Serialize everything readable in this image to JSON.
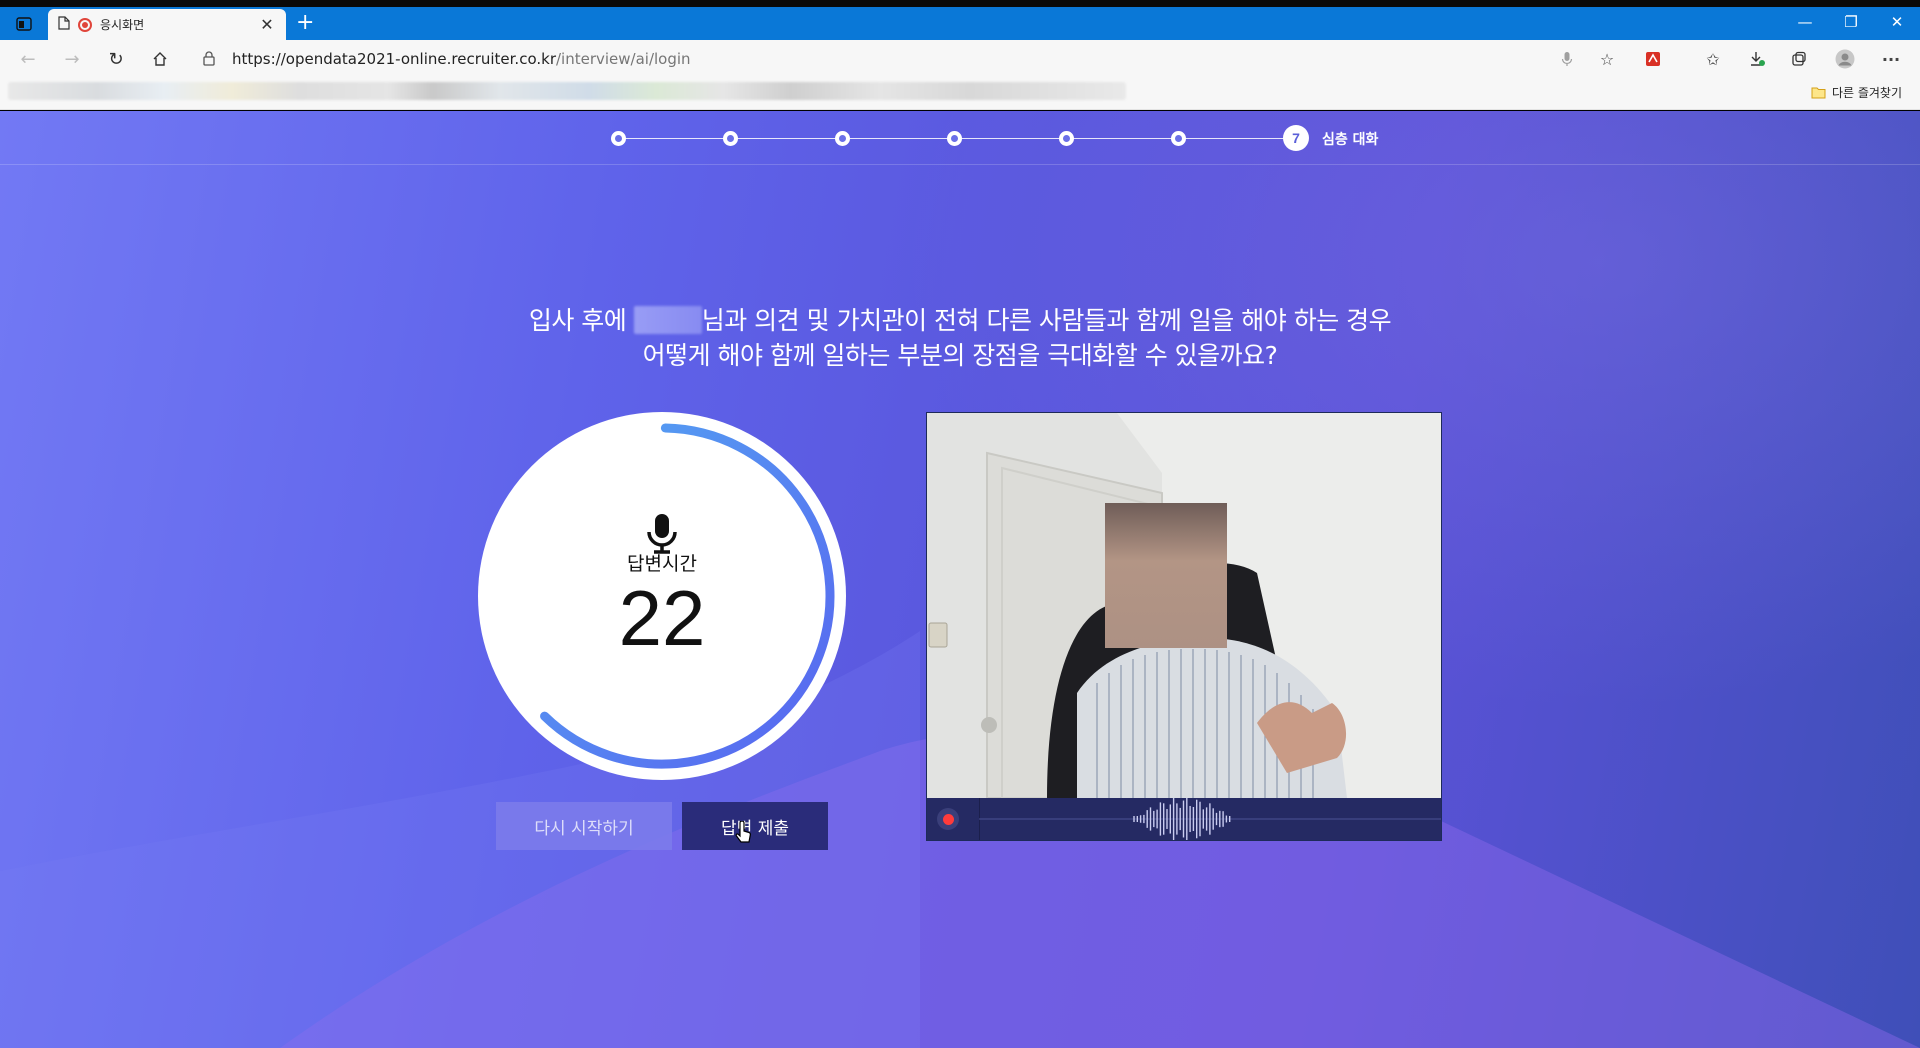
{
  "browser": {
    "tab_title": "응시화면",
    "url_host": "https://opendata2021-online.recruiter.co.kr",
    "url_path": "/interview/ai/login",
    "other_favorites": "다른 즐겨찾기",
    "accent_color": "#0a78d7"
  },
  "stepper": {
    "total_steps": 7,
    "current_step_number": "7",
    "current_step_label": "심층 대화"
  },
  "question": {
    "line1_before_name": "입사 후에 ",
    "line1_after_name": "님과 의견 및 가치관이 전혀 다른 사람들과 함께 일을 해야 하는 경우",
    "line2": "어떻게 해야 함께 일하는 부분의 장점을 극대화할 수 있을까요?"
  },
  "timer": {
    "label": "답변시간",
    "value": "22",
    "progress_fraction": 0.62
  },
  "buttons": {
    "restart": "다시 시작하기",
    "submit": "답변 제출"
  },
  "video": {
    "recording": true,
    "rec_color": "#ff3b3b"
  }
}
